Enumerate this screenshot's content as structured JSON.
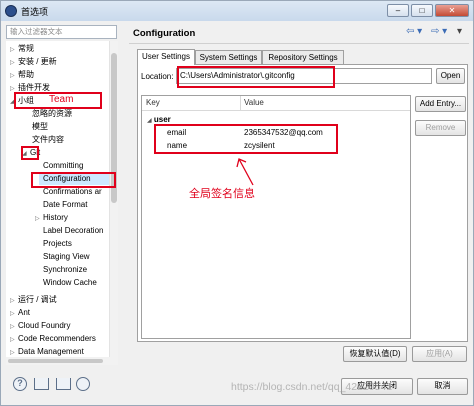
{
  "window": {
    "title": "首选项",
    "min_label": "–",
    "max_label": "□",
    "close_label": "✕"
  },
  "filter": {
    "placeholder": "输入过滤器文本"
  },
  "tree": {
    "items": [
      {
        "label": "常规",
        "arrow": "▷"
      },
      {
        "label": "安装 / 更新",
        "arrow": "▷"
      },
      {
        "label": "帮助",
        "arrow": "▷"
      },
      {
        "label": "插件开发",
        "arrow": "▷"
      },
      {
        "label": "小组",
        "arrow": "◢"
      },
      {
        "label": "忽略的资源",
        "arrow": ""
      },
      {
        "label": "模型",
        "arrow": ""
      },
      {
        "label": "文件内容",
        "arrow": ""
      },
      {
        "label": "Git",
        "arrow": "◢"
      },
      {
        "label": "Committing",
        "arrow": ""
      },
      {
        "label": "Configuration",
        "arrow": ""
      },
      {
        "label": "Confirmations ar",
        "arrow": ""
      },
      {
        "label": "Date Format",
        "arrow": ""
      },
      {
        "label": "History",
        "arrow": "▷"
      },
      {
        "label": "Label Decoration",
        "arrow": ""
      },
      {
        "label": "Projects",
        "arrow": ""
      },
      {
        "label": "Staging View",
        "arrow": ""
      },
      {
        "label": "Synchronize",
        "arrow": ""
      },
      {
        "label": "Window Cache",
        "arrow": ""
      },
      {
        "label": "运行 / 调试",
        "arrow": "▷"
      },
      {
        "label": "Ant",
        "arrow": "▷"
      },
      {
        "label": "Cloud Foundry",
        "arrow": "▷"
      },
      {
        "label": "Code Recommenders",
        "arrow": "▷"
      },
      {
        "label": "Data Management",
        "arrow": "▷"
      }
    ]
  },
  "page": {
    "title": "Configuration",
    "nav_back": "⇦ ▾",
    "nav_forward": "⇨ ▾",
    "nav_menu": "▾"
  },
  "tabs": {
    "user": "User Settings",
    "system": "System Settings",
    "repository": "Repository Settings"
  },
  "location": {
    "label": "Location:",
    "value": "C:\\Users\\Administrator\\.gitconfig",
    "open_button": "Open"
  },
  "table": {
    "key_header": "Key",
    "value_header": "Value",
    "section": "user",
    "section_arrow": "◢",
    "rows": [
      {
        "key": "email",
        "value": "2365347532@qq.com"
      },
      {
        "key": "name",
        "value": "zcysilent"
      }
    ]
  },
  "side_buttons": {
    "add": "Add Entry...",
    "remove": "Remove"
  },
  "footer_buttons": {
    "restore": "恢复默认值(D)",
    "apply": "应用(A)",
    "apply_close": "应用并关闭",
    "cancel": "取消"
  },
  "annotations": {
    "team": "Team",
    "signature": "全局签名信息"
  },
  "watermark": "https://blog.csdn.net/qq_42220541",
  "colors": {
    "annotation_red": "#e0001b",
    "selection_blue": "#cde8ff"
  }
}
